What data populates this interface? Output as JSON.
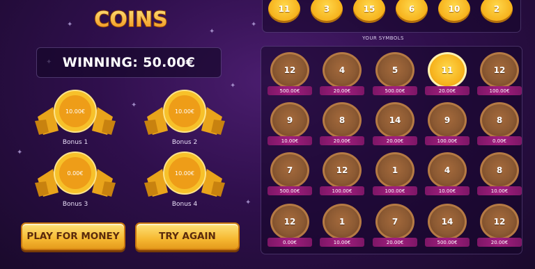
{
  "logo": {
    "text": "COINS",
    "icon": "lucky-coins-logo"
  },
  "winning": {
    "label": "WINNING: 50.00€"
  },
  "bonuses": [
    {
      "value": "10.00€",
      "label": "Bonus 1"
    },
    {
      "value": "10.00€",
      "label": "Bonus 2"
    },
    {
      "value": "0.00€",
      "label": "Bonus 3"
    },
    {
      "value": "10.00€",
      "label": "Bonus 4"
    }
  ],
  "buttons": {
    "play": "PLAY FOR MONEY",
    "try": "TRY AGAIN"
  },
  "winning_numbers": [
    "11",
    "3",
    "15",
    "6",
    "10",
    "2"
  ],
  "symbols_title": "YOUR SYMBOLS",
  "symbols": [
    {
      "num": "12",
      "prize": "500.00€",
      "match": false
    },
    {
      "num": "4",
      "prize": "20.00€",
      "match": false
    },
    {
      "num": "5",
      "prize": "500.00€",
      "match": false
    },
    {
      "num": "11",
      "prize": "20.00€",
      "match": true
    },
    {
      "num": "12",
      "prize": "100.00€",
      "match": false
    },
    {
      "num": "9",
      "prize": "10.00€",
      "match": false
    },
    {
      "num": "8",
      "prize": "20.00€",
      "match": false
    },
    {
      "num": "14",
      "prize": "20.00€",
      "match": false
    },
    {
      "num": "9",
      "prize": "100.00€",
      "match": false
    },
    {
      "num": "8",
      "prize": "0.00€",
      "match": false
    },
    {
      "num": "7",
      "prize": "500.00€",
      "match": false
    },
    {
      "num": "12",
      "prize": "100.00€",
      "match": false
    },
    {
      "num": "1",
      "prize": "100.00€",
      "match": false
    },
    {
      "num": "4",
      "prize": "10.00€",
      "match": false
    },
    {
      "num": "8",
      "prize": "10.00€",
      "match": false
    },
    {
      "num": "12",
      "prize": "0.00€",
      "match": false
    },
    {
      "num": "1",
      "prize": "10.00€",
      "match": false
    },
    {
      "num": "7",
      "prize": "20.00€",
      "match": false
    },
    {
      "num": "14",
      "prize": "500.00€",
      "match": false
    },
    {
      "num": "12",
      "prize": "20.00€",
      "match": false
    }
  ],
  "colors": {
    "background": "#2f0f4c",
    "gold": "#f6b21c",
    "bronze": "#8c5a33",
    "prize_bar": "#a31f7f"
  }
}
